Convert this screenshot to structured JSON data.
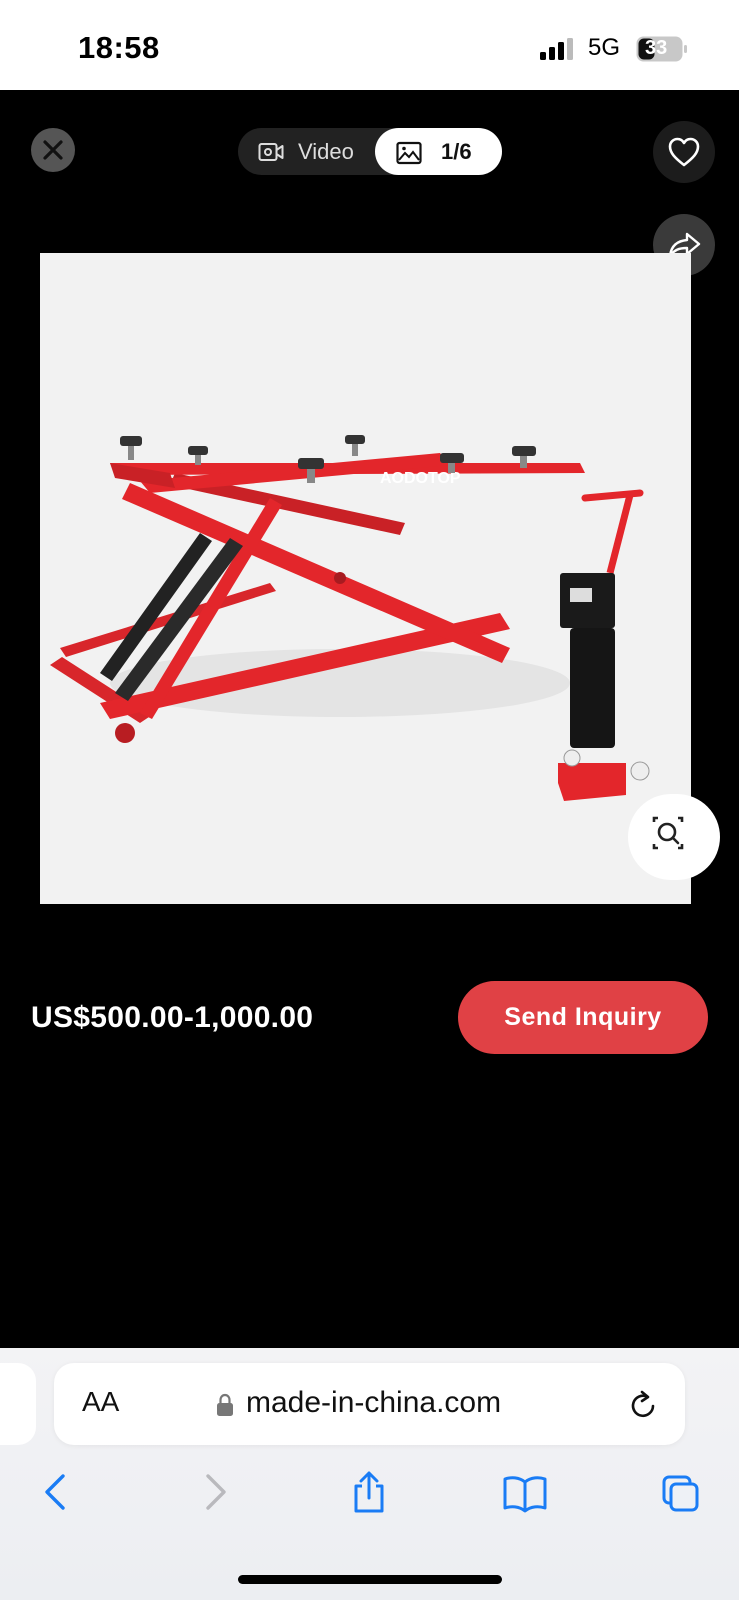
{
  "status_bar": {
    "time": "18:58",
    "network": "5G",
    "battery": "33"
  },
  "viewer": {
    "video_label": "Video",
    "image_count": "1/6",
    "product_brand_mark": "AODOTOP"
  },
  "purchase": {
    "price": "US$500.00-1,000.00",
    "inquiry_label": "Send Inquiry"
  },
  "browser": {
    "aa_label": "AA",
    "url": "made-in-china.com"
  },
  "colors": {
    "accent": "#e04145",
    "ios_blue": "#1a7cf5",
    "lift_red": "#e3262b"
  }
}
